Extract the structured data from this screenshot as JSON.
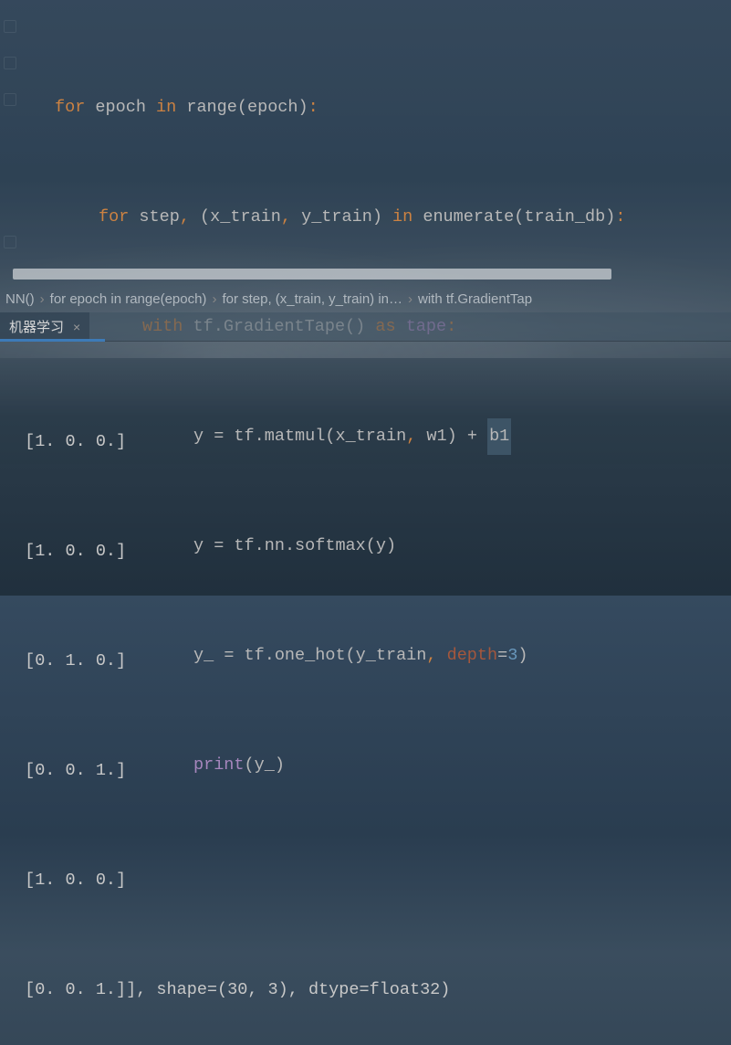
{
  "code": {
    "l0_kw1": "for",
    "l0_v1": " epoch ",
    "l0_kw2": "in",
    "l0_fn": " range",
    "l0_p1": "(",
    "l0_v2": "epoch",
    "l0_p2": ")",
    "l0_col": ":",
    "l1_kw1": "for",
    "l1_v1": " step",
    "l1_c1": ", ",
    "l1_p1": "(",
    "l1_v2": "x_train",
    "l1_c2": ", ",
    "l1_v3": "y_train",
    "l1_p2": ") ",
    "l1_kw2": "in",
    "l1_fn": " enumerate",
    "l1_p3": "(",
    "l1_v4": "train_db",
    "l1_p4": ")",
    "l1_col": ":",
    "l2_kw": "with",
    "l2_v1": " tf.GradientTape",
    "l2_p": "() ",
    "l2_kw2": "as",
    "l2_v2": " tape",
    "l2_col": ":",
    "l3_v1": "y ",
    "l3_op": "=",
    "l3_v2": " tf.matmul",
    "l3_p1": "(",
    "l3_v3": "x_train",
    "l3_c1": ", ",
    "l3_v4": "w1",
    "l3_p2": ") ",
    "l3_plus": "+",
    "l3_sp": " ",
    "l3_v5": "b1",
    "l4_v1": "y ",
    "l4_op": "=",
    "l4_v2": " tf.nn.softmax",
    "l4_p1": "(",
    "l4_v3": "y",
    "l4_p2": ")",
    "l5_v1": "y_ ",
    "l5_op": "=",
    "l5_v2": " tf.one_hot",
    "l5_p1": "(",
    "l5_v3": "y_train",
    "l5_c1": ", ",
    "l5_arg": "depth",
    "l5_eq": "=",
    "l5_num": "3",
    "l5_p2": ")",
    "l6_fn": "print",
    "l6_p1": "(",
    "l6_v1": "y_",
    "l6_p2": ")"
  },
  "breadcrumb": {
    "b0": "NN()",
    "b1": "for epoch in range(epoch)",
    "b2": "for step, (x_train, y_train) in…",
    "b3": "with tf.GradientTap",
    "chev": "›"
  },
  "tab": {
    "label": "机器学习",
    "close": "×"
  },
  "output": {
    "o0": " [1. 0. 0.]",
    "o1": " [1. 0. 0.]",
    "o2": " [0. 1. 0.]",
    "o3": " [0. 0. 1.]",
    "o4": " [1. 0. 0.]",
    "o5": " [0. 0. 1.]], shape=(30, 3), dtype=float32)"
  }
}
